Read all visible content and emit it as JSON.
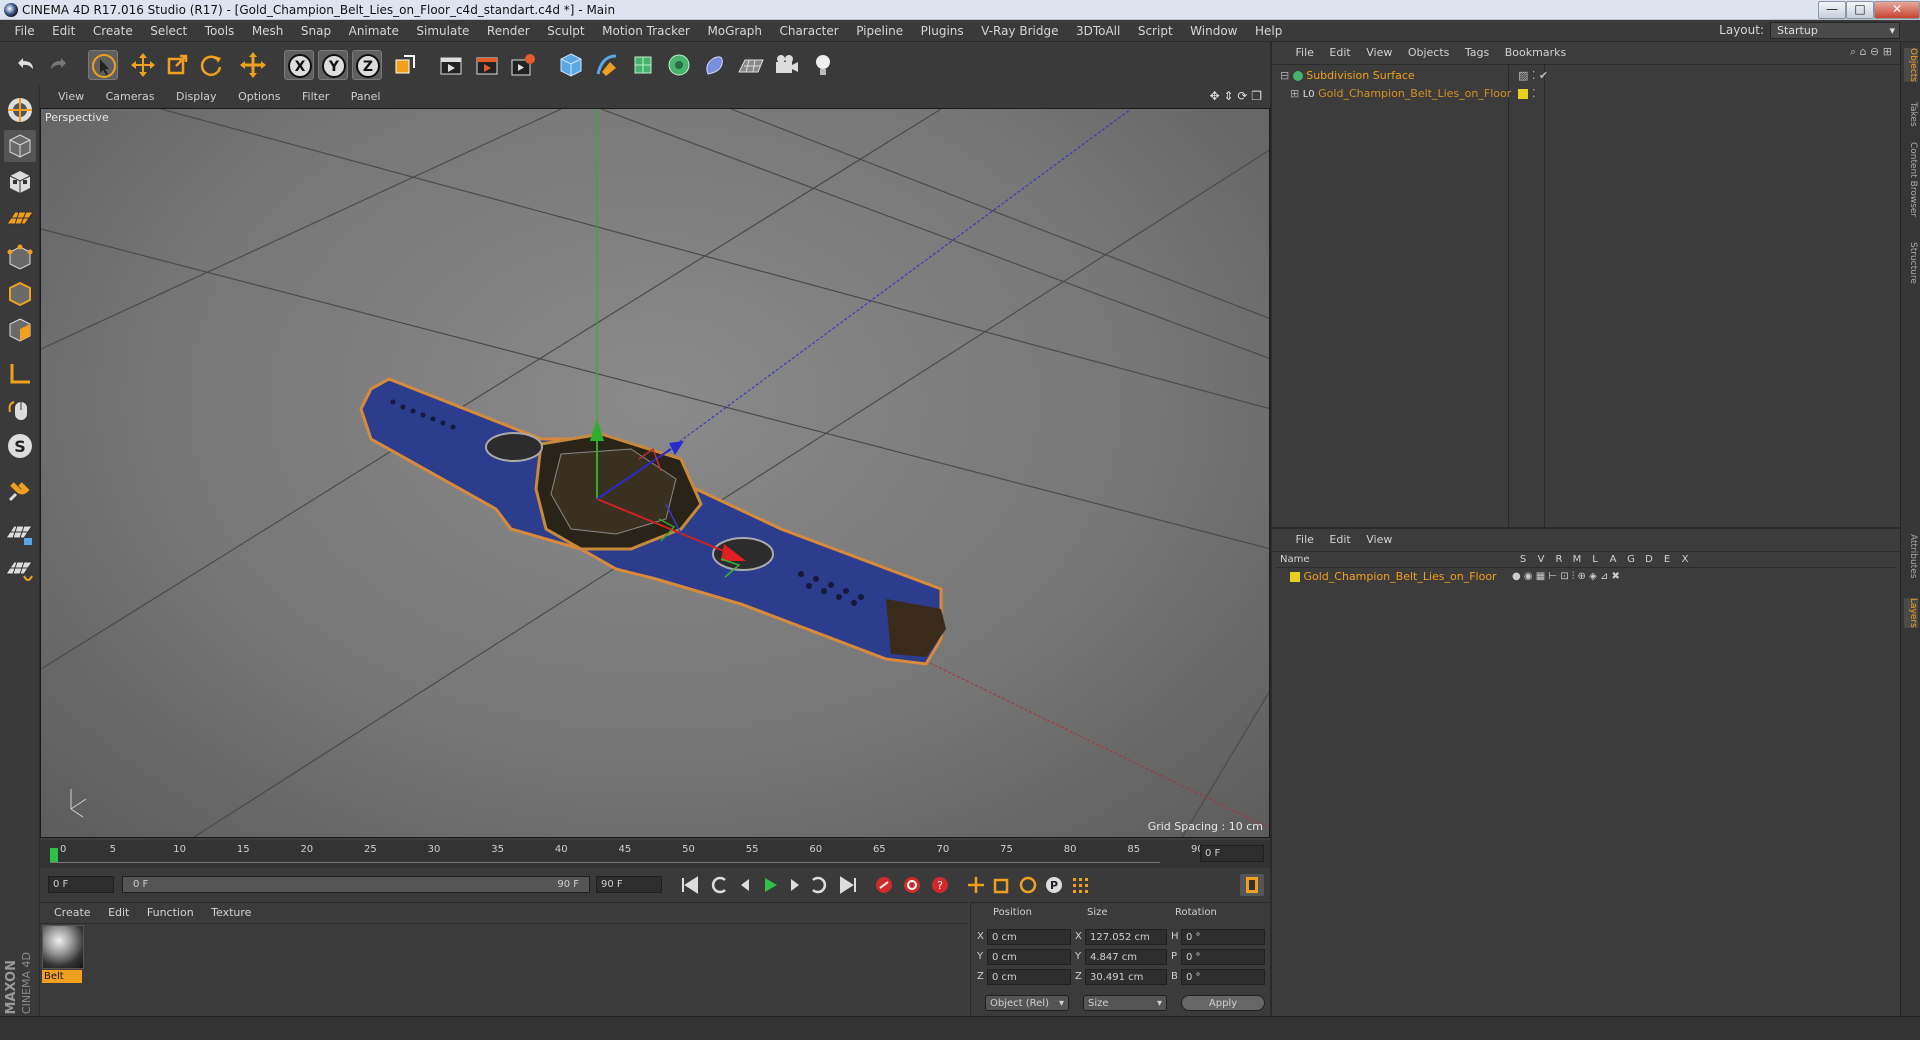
{
  "window": {
    "title": "CINEMA 4D R17.016 Studio (R17) - [Gold_Champion_Belt_Lies_on_Floor_c4d_standart.c4d *] - Main",
    "minimize": "—",
    "maximize": "□",
    "close": "✕"
  },
  "menubar": {
    "items": [
      "File",
      "Edit",
      "Create",
      "Select",
      "Tools",
      "Mesh",
      "Snap",
      "Animate",
      "Simulate",
      "Render",
      "Sculpt",
      "Motion Tracker",
      "MoGraph",
      "Character",
      "Pipeline",
      "Plugins",
      "V-Ray Bridge",
      "3DToAll",
      "Script",
      "Window",
      "Help"
    ],
    "layout_label": "Layout:",
    "layout_value": "Startup"
  },
  "toolbar": {
    "icons": [
      "undo-icon",
      "redo-icon",
      "live-selection-icon",
      "move-icon",
      "scale-icon",
      "rotate-icon",
      "move-plus-icon",
      "x-axis-icon",
      "y-axis-icon",
      "z-axis-icon",
      "coordinate-system-icon",
      "render-view-icon",
      "render-picture-viewer-icon",
      "render-settings-icon",
      "cube-icon",
      "pen-icon",
      "subdivision-icon",
      "cloner-icon",
      "deformer-icon",
      "floor-icon",
      "camera-icon",
      "light-icon"
    ],
    "axis_labels": [
      "X",
      "Y",
      "Z"
    ]
  },
  "viewport": {
    "menu": [
      "View",
      "Cameras",
      "Display",
      "Options",
      "Filter",
      "Panel"
    ],
    "label": "Perspective",
    "grid_spacing": "Grid Spacing : 10 cm"
  },
  "timeline": {
    "ticks": [
      "0",
      "5",
      "10",
      "15",
      "20",
      "25",
      "30",
      "35",
      "40",
      "45",
      "50",
      "55",
      "60",
      "65",
      "70",
      "75",
      "80",
      "85",
      "90"
    ],
    "current_frame_box": "0 F",
    "start": "0 F",
    "range_start": "0 F",
    "range_end": "90 F",
    "end": "90 F"
  },
  "material_manager": {
    "menu": [
      "Create",
      "Edit",
      "Function",
      "Texture"
    ],
    "materials": [
      {
        "name": "Belt"
      }
    ]
  },
  "coordinates": {
    "headers": [
      "Position",
      "Size",
      "Rotation"
    ],
    "rows": [
      {
        "axis": "X",
        "pos": "0 cm",
        "size_axis": "X",
        "size": "127.052 cm",
        "rot_axis": "H",
        "rot": "0 °"
      },
      {
        "axis": "Y",
        "pos": "0 cm",
        "size_axis": "Y",
        "size": "4.847 cm",
        "rot_axis": "P",
        "rot": "0 °"
      },
      {
        "axis": "Z",
        "pos": "0 cm",
        "size_axis": "Z",
        "size": "30.491 cm",
        "rot_axis": "B",
        "rot": "0 °"
      }
    ],
    "mode": "Object (Rel)",
    "size_mode": "Size",
    "apply": "Apply"
  },
  "object_manager": {
    "menu": [
      "File",
      "Edit",
      "View",
      "Objects",
      "Tags",
      "Bookmarks"
    ],
    "objects": [
      {
        "name": "Subdivision Surface"
      },
      {
        "name": "Gold_Champion_Belt_Lies_on_Floor"
      }
    ]
  },
  "layer_manager": {
    "menu": [
      "File",
      "Edit",
      "View"
    ],
    "name_header": "Name",
    "columns": [
      "S",
      "V",
      "R",
      "M",
      "L",
      "A",
      "G",
      "D",
      "E",
      "X"
    ],
    "layers": [
      {
        "name": "Gold_Champion_Belt_Lies_on_Floor"
      }
    ]
  },
  "right_tabs": [
    "Objects",
    "Takes",
    "Content Browser",
    "Structure",
    "Attributes",
    "Layers"
  ],
  "brand": {
    "maxon": "MAXON",
    "cinema": "CINEMA 4D"
  },
  "colors": {
    "accent": "#f0a01e",
    "selection_blue": "#4a7fd0",
    "belt_blue": "#2b3d8c"
  }
}
